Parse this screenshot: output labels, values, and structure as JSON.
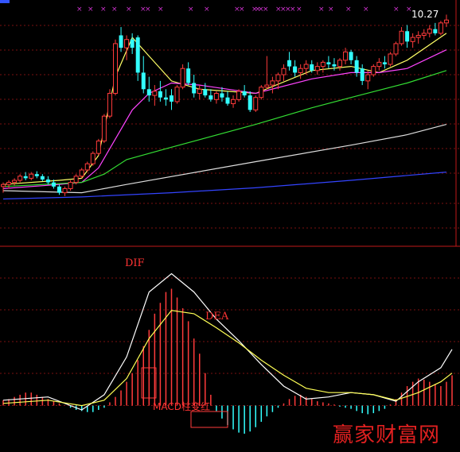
{
  "chart_data": [
    {
      "type": "candlestick",
      "title": "",
      "price_label": "10.27",
      "y_scale": [
        5.0,
        10.6
      ],
      "candles": [
        {
          "o": 6.25,
          "h": 6.35,
          "l": 6.1,
          "c": 6.3
        },
        {
          "o": 6.3,
          "h": 6.4,
          "l": 6.2,
          "c": 6.35
        },
        {
          "o": 6.35,
          "h": 6.45,
          "l": 6.28,
          "c": 6.4
        },
        {
          "o": 6.4,
          "h": 6.55,
          "l": 6.35,
          "c": 6.5
        },
        {
          "o": 6.5,
          "h": 6.6,
          "l": 6.4,
          "c": 6.45
        },
        {
          "o": 6.45,
          "h": 6.6,
          "l": 6.4,
          "c": 6.55
        },
        {
          "o": 6.55,
          "h": 6.62,
          "l": 6.45,
          "c": 6.5
        },
        {
          "o": 6.5,
          "h": 6.55,
          "l": 6.38,
          "c": 6.42
        },
        {
          "o": 6.42,
          "h": 6.5,
          "l": 6.3,
          "c": 6.35
        },
        {
          "o": 6.35,
          "h": 6.42,
          "l": 6.2,
          "c": 6.25
        },
        {
          "o": 6.25,
          "h": 6.3,
          "l": 6.05,
          "c": 6.1
        },
        {
          "o": 6.1,
          "h": 6.25,
          "l": 6.02,
          "c": 6.2
        },
        {
          "o": 6.2,
          "h": 6.4,
          "l": 6.15,
          "c": 6.35
        },
        {
          "o": 6.35,
          "h": 6.55,
          "l": 6.3,
          "c": 6.5
        },
        {
          "o": 6.5,
          "h": 6.7,
          "l": 6.45,
          "c": 6.65
        },
        {
          "o": 6.65,
          "h": 6.85,
          "l": 6.6,
          "c": 6.8
        },
        {
          "o": 6.8,
          "h": 7.1,
          "l": 6.75,
          "c": 7.05
        },
        {
          "o": 7.05,
          "h": 7.4,
          "l": 7.0,
          "c": 7.35
        },
        {
          "o": 7.35,
          "h": 8.0,
          "l": 7.3,
          "c": 7.95
        },
        {
          "o": 7.95,
          "h": 8.6,
          "l": 7.9,
          "c": 8.5
        },
        {
          "o": 8.5,
          "h": 9.8,
          "l": 8.45,
          "c": 9.7
        },
        {
          "o": 9.9,
          "h": 10.1,
          "l": 9.5,
          "c": 9.6
        },
        {
          "o": 9.6,
          "h": 9.9,
          "l": 9.3,
          "c": 9.8
        },
        {
          "o": 9.8,
          "h": 9.95,
          "l": 9.45,
          "c": 9.6
        },
        {
          "o": 9.85,
          "h": 9.9,
          "l": 8.8,
          "c": 9.0
        },
        {
          "o": 9.0,
          "h": 9.4,
          "l": 8.5,
          "c": 8.6
        },
        {
          "o": 8.6,
          "h": 8.9,
          "l": 8.3,
          "c": 8.45
        },
        {
          "o": 8.45,
          "h": 8.7,
          "l": 8.2,
          "c": 8.55
        },
        {
          "o": 8.55,
          "h": 8.8,
          "l": 8.3,
          "c": 8.4
        },
        {
          "o": 8.4,
          "h": 8.6,
          "l": 8.2,
          "c": 8.35
        },
        {
          "o": 8.45,
          "h": 8.6,
          "l": 8.1,
          "c": 8.3
        },
        {
          "o": 8.3,
          "h": 8.7,
          "l": 8.25,
          "c": 8.65
        },
        {
          "o": 8.65,
          "h": 9.2,
          "l": 8.6,
          "c": 9.1
        },
        {
          "o": 9.1,
          "h": 9.25,
          "l": 8.7,
          "c": 8.75
        },
        {
          "o": 8.75,
          "h": 8.95,
          "l": 8.4,
          "c": 8.5
        },
        {
          "o": 8.5,
          "h": 8.7,
          "l": 8.35,
          "c": 8.6
        },
        {
          "o": 8.6,
          "h": 8.75,
          "l": 8.4,
          "c": 8.45
        },
        {
          "o": 8.45,
          "h": 8.6,
          "l": 8.3,
          "c": 8.35
        },
        {
          "o": 8.35,
          "h": 8.55,
          "l": 8.25,
          "c": 8.5
        },
        {
          "o": 8.5,
          "h": 8.65,
          "l": 8.3,
          "c": 8.4
        },
        {
          "o": 8.4,
          "h": 8.55,
          "l": 8.2,
          "c": 8.25
        },
        {
          "o": 8.25,
          "h": 8.45,
          "l": 8.15,
          "c": 8.35
        },
        {
          "o": 8.35,
          "h": 8.6,
          "l": 8.3,
          "c": 8.55
        },
        {
          "o": 8.55,
          "h": 8.7,
          "l": 8.4,
          "c": 8.45
        },
        {
          "o": 8.45,
          "h": 8.55,
          "l": 8.05,
          "c": 8.1
        },
        {
          "o": 8.1,
          "h": 8.45,
          "l": 8.05,
          "c": 8.4
        },
        {
          "o": 8.4,
          "h": 8.7,
          "l": 8.35,
          "c": 8.65
        },
        {
          "o": 8.65,
          "h": 9.4,
          "l": 8.6,
          "c": 8.7
        },
        {
          "o": 8.7,
          "h": 8.9,
          "l": 8.5,
          "c": 8.8
        },
        {
          "o": 8.8,
          "h": 9.0,
          "l": 8.6,
          "c": 8.95
        },
        {
          "o": 8.95,
          "h": 9.2,
          "l": 8.8,
          "c": 9.1
        },
        {
          "o": 9.3,
          "h": 9.5,
          "l": 9.05,
          "c": 9.15
        },
        {
          "o": 9.15,
          "h": 9.3,
          "l": 8.9,
          "c": 9.0
        },
        {
          "o": 9.0,
          "h": 9.2,
          "l": 8.85,
          "c": 9.1
        },
        {
          "o": 9.1,
          "h": 9.3,
          "l": 8.95,
          "c": 9.2
        },
        {
          "o": 9.2,
          "h": 9.3,
          "l": 9.0,
          "c": 9.05
        },
        {
          "o": 9.05,
          "h": 9.25,
          "l": 8.95,
          "c": 9.15
        },
        {
          "o": 9.15,
          "h": 9.3,
          "l": 9.0,
          "c": 9.25
        },
        {
          "o": 9.25,
          "h": 9.4,
          "l": 9.1,
          "c": 9.2
        },
        {
          "o": 9.2,
          "h": 9.35,
          "l": 9.05,
          "c": 9.15
        },
        {
          "o": 9.15,
          "h": 9.35,
          "l": 9.05,
          "c": 9.3
        },
        {
          "o": 9.3,
          "h": 9.6,
          "l": 9.2,
          "c": 9.5
        },
        {
          "o": 9.5,
          "h": 9.55,
          "l": 9.2,
          "c": 9.3
        },
        {
          "o": 9.3,
          "h": 9.4,
          "l": 8.9,
          "c": 9.0
        },
        {
          "o": 9.1,
          "h": 9.2,
          "l": 8.7,
          "c": 8.8
        },
        {
          "o": 8.8,
          "h": 9.05,
          "l": 8.6,
          "c": 8.95
        },
        {
          "o": 8.95,
          "h": 9.2,
          "l": 8.9,
          "c": 9.15
        },
        {
          "o": 9.15,
          "h": 9.35,
          "l": 9.05,
          "c": 9.25
        },
        {
          "o": 9.25,
          "h": 9.4,
          "l": 9.1,
          "c": 9.2
        },
        {
          "o": 9.2,
          "h": 9.5,
          "l": 9.15,
          "c": 9.45
        },
        {
          "o": 9.45,
          "h": 9.75,
          "l": 9.4,
          "c": 9.7
        },
        {
          "o": 9.7,
          "h": 10.1,
          "l": 9.65,
          "c": 10.0
        },
        {
          "o": 10.0,
          "h": 10.15,
          "l": 9.6,
          "c": 9.75
        },
        {
          "o": 9.75,
          "h": 9.95,
          "l": 9.6,
          "c": 9.85
        },
        {
          "o": 9.85,
          "h": 10.0,
          "l": 9.7,
          "c": 9.9
        },
        {
          "o": 9.9,
          "h": 10.05,
          "l": 9.8,
          "c": 9.95
        },
        {
          "o": 9.95,
          "h": 10.15,
          "l": 9.85,
          "c": 10.05
        },
        {
          "o": 10.05,
          "h": 10.2,
          "l": 9.9,
          "c": 9.95
        },
        {
          "o": 9.95,
          "h": 10.25,
          "l": 9.9,
          "c": 10.2
        },
        {
          "o": 10.2,
          "h": 10.4,
          "l": 10.1,
          "c": 10.27
        }
      ],
      "moving_averages": [
        {
          "color": "#ffff66",
          "points": [
            [
              0,
              6.3
            ],
            [
              10,
              6.4
            ],
            [
              14,
              6.45
            ],
            [
              17,
              7.0
            ],
            [
              20,
              8.9
            ],
            [
              23,
              9.85
            ],
            [
              26,
              9.4
            ],
            [
              30,
              8.8
            ],
            [
              35,
              8.6
            ],
            [
              45,
              8.5
            ],
            [
              55,
              9.05
            ],
            [
              62,
              9.15
            ],
            [
              67,
              9.0
            ],
            [
              72,
              9.3
            ],
            [
              79,
              9.95
            ]
          ]
        },
        {
          "color": "#ff44ff",
          "points": [
            [
              0,
              6.2
            ],
            [
              10,
              6.3
            ],
            [
              14,
              6.35
            ],
            [
              17,
              6.7
            ],
            [
              20,
              7.4
            ],
            [
              23,
              8.1
            ],
            [
              26,
              8.5
            ],
            [
              30,
              8.75
            ],
            [
              35,
              8.7
            ],
            [
              45,
              8.5
            ],
            [
              55,
              8.85
            ],
            [
              62,
              9.0
            ],
            [
              67,
              9.0
            ],
            [
              72,
              9.1
            ],
            [
              79,
              9.55
            ]
          ]
        },
        {
          "color": "#33dd33",
          "points": [
            [
              0,
              6.25
            ],
            [
              14,
              6.35
            ],
            [
              18,
              6.55
            ],
            [
              22,
              6.9
            ],
            [
              30,
              7.2
            ],
            [
              45,
              7.75
            ],
            [
              55,
              8.15
            ],
            [
              62,
              8.4
            ],
            [
              72,
              8.75
            ],
            [
              79,
              9.05
            ]
          ]
        },
        {
          "color": "#dddddd",
          "points": [
            [
              0,
              6.15
            ],
            [
              14,
              6.1
            ],
            [
              22,
              6.3
            ],
            [
              45,
              6.85
            ],
            [
              62,
              7.25
            ],
            [
              72,
              7.5
            ],
            [
              79,
              7.75
            ]
          ]
        },
        {
          "color": "#3344ff",
          "points": [
            [
              0,
              5.95
            ],
            [
              14,
              6.0
            ],
            [
              30,
              6.1
            ],
            [
              45,
              6.22
            ],
            [
              62,
              6.4
            ],
            [
              79,
              6.6
            ]
          ]
        }
      ]
    },
    {
      "type": "macd",
      "title": "",
      "y_scale": [
        -0.4,
        1.4
      ],
      "annotations": {
        "dif": "DIF",
        "dea": "DEA",
        "macd_note": "MACD柱变红"
      },
      "hist": [
        0.05,
        0.06,
        0.08,
        0.1,
        0.12,
        0.12,
        0.1,
        0.08,
        0.06,
        0.04,
        0.02,
        0.0,
        -0.02,
        -0.04,
        -0.05,
        -0.06,
        -0.06,
        -0.04,
        -0.02,
        0.03,
        0.08,
        0.14,
        0.22,
        0.3,
        0.42,
        0.55,
        0.7,
        0.85,
        0.95,
        1.05,
        1.08,
        1.0,
        0.9,
        0.78,
        0.62,
        0.48,
        0.3,
        0.1,
        -0.05,
        -0.12,
        -0.18,
        -0.22,
        -0.25,
        -0.26,
        -0.24,
        -0.2,
        -0.15,
        -0.1,
        -0.06,
        -0.02,
        0.02,
        0.06,
        0.09,
        0.1,
        0.08,
        0.06,
        0.04,
        0.03,
        0.02,
        0.01,
        -0.01,
        -0.02,
        -0.03,
        -0.05,
        -0.07,
        -0.08,
        -0.07,
        -0.05,
        -0.03,
        0.01,
        0.06,
        0.12,
        0.18,
        0.22,
        0.25,
        0.24,
        0.22,
        0.2,
        0.18,
        0.22,
        0.28
      ],
      "dif": [
        [
          0,
          0.05
        ],
        [
          8,
          0.08
        ],
        [
          14,
          -0.04
        ],
        [
          18,
          0.1
        ],
        [
          22,
          0.45
        ],
        [
          26,
          1.05
        ],
        [
          30,
          1.22
        ],
        [
          34,
          1.05
        ],
        [
          38,
          0.8
        ],
        [
          42,
          0.6
        ],
        [
          46,
          0.38
        ],
        [
          50,
          0.18
        ],
        [
          54,
          0.06
        ],
        [
          58,
          0.08
        ],
        [
          62,
          0.12
        ],
        [
          66,
          0.1
        ],
        [
          70,
          0.04
        ],
        [
          74,
          0.22
        ],
        [
          78,
          0.35
        ],
        [
          80,
          0.52
        ]
      ],
      "dea": [
        [
          0,
          0.02
        ],
        [
          8,
          0.05
        ],
        [
          14,
          0.0
        ],
        [
          18,
          0.05
        ],
        [
          22,
          0.25
        ],
        [
          26,
          0.62
        ],
        [
          30,
          0.88
        ],
        [
          34,
          0.85
        ],
        [
          38,
          0.72
        ],
        [
          42,
          0.58
        ],
        [
          46,
          0.42
        ],
        [
          50,
          0.28
        ],
        [
          54,
          0.16
        ],
        [
          58,
          0.12
        ],
        [
          62,
          0.12
        ],
        [
          66,
          0.1
        ],
        [
          70,
          0.05
        ],
        [
          74,
          0.12
        ],
        [
          78,
          0.22
        ],
        [
          80,
          0.3
        ]
      ]
    }
  ],
  "watermark": "赢家财富网"
}
